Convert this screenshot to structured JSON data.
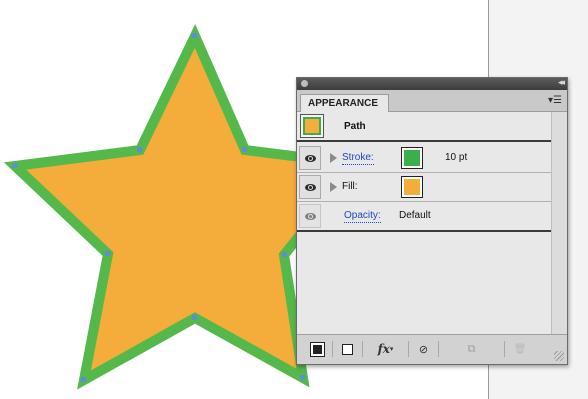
{
  "panel": {
    "tab_label": "APPEARANCE",
    "menu_icon": "panel-menu-icon",
    "collapse_glyph": "◂◂",
    "rows": {
      "path": {
        "label": "Path"
      },
      "stroke": {
        "label": "Stroke:",
        "weight": "10 pt",
        "color": "#3cae4b"
      },
      "fill": {
        "label": "Fill:",
        "color": "#f4ac3a"
      },
      "opacity": {
        "label": "Opacity:",
        "value": "Default"
      }
    },
    "bottom_buttons": {
      "fx_label": "fx",
      "clear_glyph": "⊘",
      "trash_glyph": "🗑"
    }
  },
  "artwork": {
    "fill_color": "#f4ac3a",
    "stroke_color": "#55b84a",
    "anchor_color": "#5a8fd8"
  }
}
